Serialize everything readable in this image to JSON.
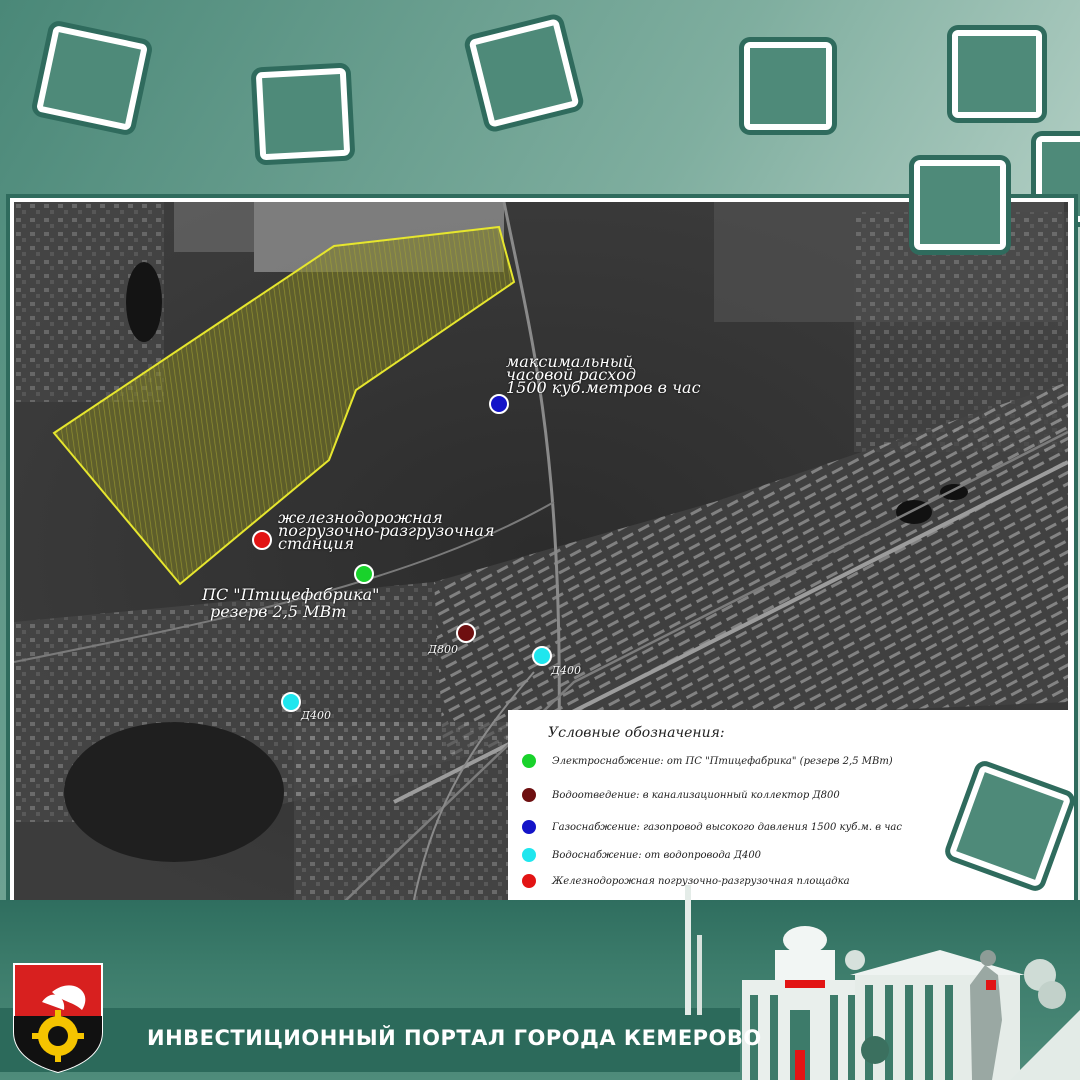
{
  "footer": {
    "title": "ИНВЕСТИЦИОННЫЙ ПОРТАЛ ГОРОДА КЕМЕРОВО"
  },
  "colors": {
    "electric": "#19d22b",
    "sewer": "#6e0f10",
    "gas": "#1414c8",
    "water": "#1fe6ee",
    "rail": "#e21414",
    "site_outline": "#e6e62e",
    "site_fill": "#8a8a1c"
  },
  "map": {
    "annotations": {
      "gas_1": "максимальный",
      "gas_2": "часовой расход",
      "gas_3": "1500 куб.метров в час",
      "rail_1": "железнодорожная",
      "rail_2": "погрузочно-разгрузочная",
      "rail_3": "станция",
      "ps_1": "ПС \"Птицефабрика\"",
      "ps_2": "резерв 2,5 МВт",
      "d800": "Д800",
      "d400_a": "Д400",
      "d400_b": "Д400"
    }
  },
  "legend": {
    "title": "Условные обозначения:",
    "items": [
      {
        "key": "electric",
        "text": "Электроснабжение: от ПС \"Птицефабрика\" (резерв 2,5 МВт)"
      },
      {
        "key": "sewer",
        "text": "Водоотведение: в канализационный коллектор Д800"
      },
      {
        "key": "gas",
        "text": "Газоснабжение: газопровод высокого давления 1500 куб.м. в час"
      },
      {
        "key": "water",
        "text": "Водоснабжение: от водопровода Д400"
      },
      {
        "key": "rail",
        "text": "Железнодорожная погрузочно-разгрузочная площадка"
      }
    ]
  }
}
